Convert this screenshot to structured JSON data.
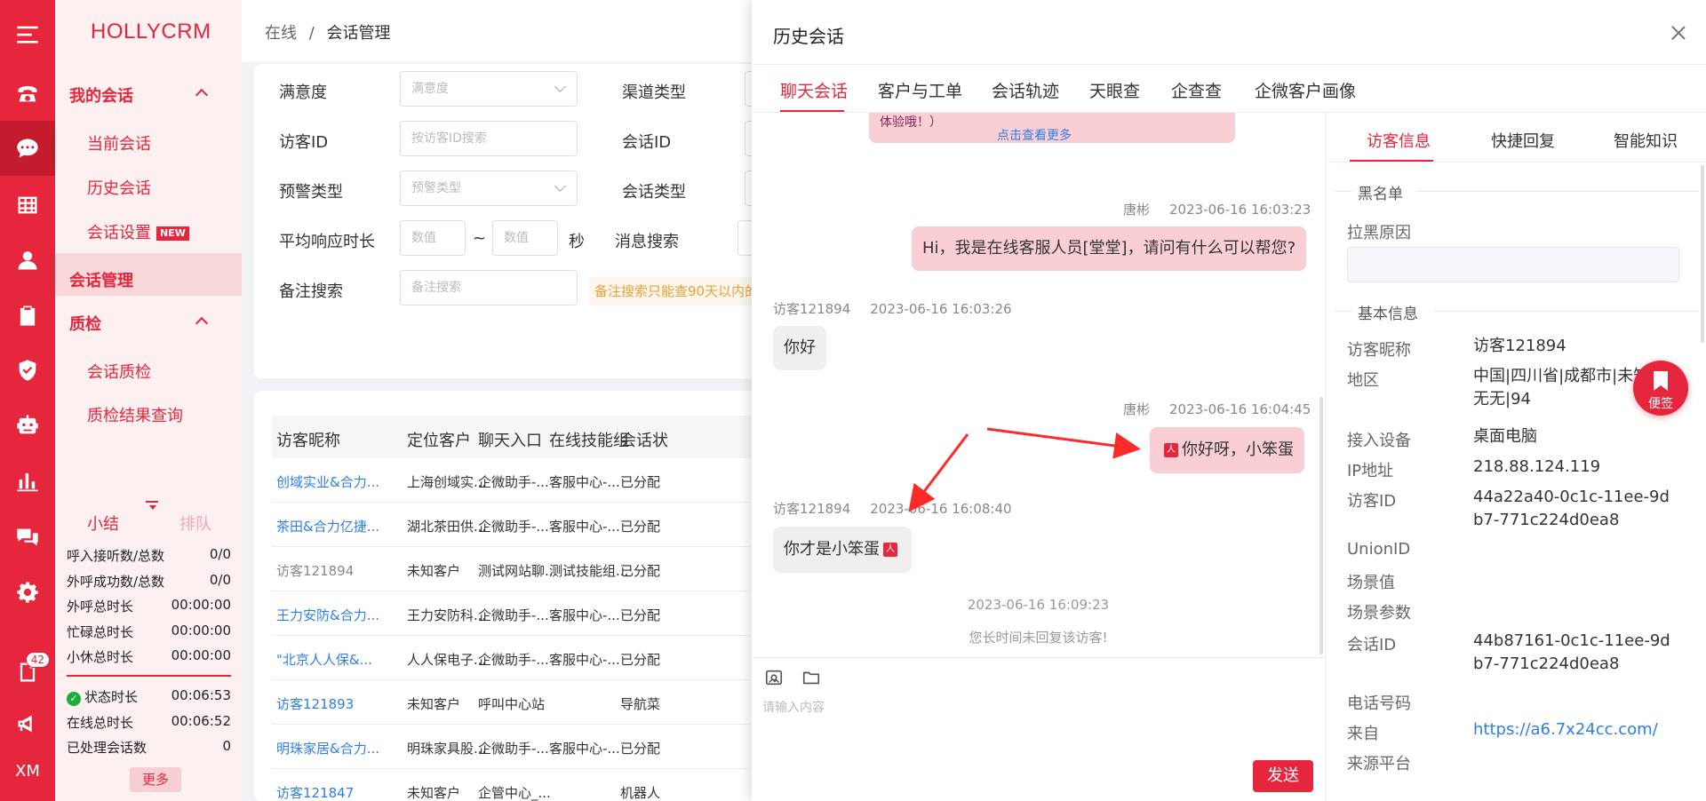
{
  "app": {
    "brand": "HOLLYCRM"
  },
  "rail": {
    "badge": "42",
    "footer": "XM"
  },
  "menu": {
    "group1": "我的会话",
    "items1": [
      "当前会话",
      "历史会话",
      "会话设置"
    ],
    "new_tag": "NEW",
    "active": "会话管理",
    "group2": "质检",
    "items2": [
      "会话质检",
      "质检结果查询"
    ],
    "stats_tabs": [
      "小结",
      "排队"
    ],
    "stats": [
      {
        "label": "呼入接听数/总数",
        "value": "0/0"
      },
      {
        "label": "外呼成功数/总数",
        "value": "0/0"
      },
      {
        "label": "外呼总时长",
        "value": "00:00:00"
      },
      {
        "label": "忙碌总时长",
        "value": "00:00:00"
      },
      {
        "label": "小休总时长",
        "value": "00:00:00"
      }
    ],
    "stats2": [
      {
        "label": "状态时长",
        "value": "00:06:53"
      },
      {
        "label": "在线总时长",
        "value": "00:06:52"
      },
      {
        "label": "已处理会话数",
        "value": "0"
      }
    ],
    "more": "更多"
  },
  "breadcrumb": {
    "root": "在线",
    "sep": "/",
    "current": "会话管理"
  },
  "filters": {
    "satisfaction": {
      "label": "满意度",
      "placeholder": "满意度"
    },
    "channel_type": {
      "label": "渠道类型"
    },
    "visitor_id": {
      "label": "访客ID",
      "placeholder": "按访客ID搜索"
    },
    "session_id": {
      "label": "会话ID"
    },
    "alert_type": {
      "label": "预警类型",
      "placeholder": "预警类型"
    },
    "session_type": {
      "label": "会话类型"
    },
    "avg_response": {
      "label": "平均响应时长",
      "min_placeholder": "数值",
      "tilde": "~",
      "max_placeholder": "数值",
      "unit": "秒"
    },
    "message_search": {
      "label": "消息搜索"
    },
    "note_search": {
      "label": "备注搜索",
      "placeholder": "备注搜索"
    },
    "tip": "备注搜索只能查90天以内的"
  },
  "table": {
    "headers": [
      "访客昵称",
      "定位客户",
      "聊天入口",
      "在线技能组",
      "会话状"
    ],
    "rows": [
      [
        "创域实业&合力...",
        "上海创域实...",
        "企微助手-...",
        "客服中心-...",
        "已分配"
      ],
      [
        "茶田&合力亿捷...",
        "湖北茶田供...",
        "企微助手-...",
        "客服中心-...",
        "已分配"
      ],
      [
        "访客121894",
        "未知客户",
        "测试网站聊...",
        "测试技能组...",
        "已分配"
      ],
      [
        "王力安防&合力...",
        "王力安防科...",
        "企微助手-...",
        "客服中心-...",
        "已分配"
      ],
      [
        "\"北京人人保&...",
        "人人保电子...",
        "企微助手-...",
        "客服中心-...",
        "已分配"
      ],
      [
        "访客121893",
        "未知客户",
        "呼叫中心站",
        "",
        "导航菜"
      ],
      [
        "明珠家居&合力...",
        "明珠家具股...",
        "企微助手-...",
        "客服中心-...",
        "已分配"
      ],
      [
        "访客121847",
        "未知客户",
        "企管中心_...",
        "",
        "机器人"
      ]
    ]
  },
  "drawer": {
    "title": "历史会话",
    "tabs": [
      "聊天会话",
      "客户与工单",
      "会话轨迹",
      "天眼查",
      "企查查",
      "企微客户画像"
    ],
    "load_more": "点击查看更多",
    "partial_msg": "体验哦！）",
    "messages": [
      {
        "sender": "唐彬",
        "time": "2023-06-16 16:03:23",
        "text": "Hi，我是在线客服人员[堂堂]，请问有什么可以帮您?"
      },
      {
        "sender": "访客121894",
        "time": "2023-06-16 16:03:26",
        "text": "你好"
      },
      {
        "sender": "唐彬",
        "time": "2023-06-16 16:04:45",
        "text": "你好呀，小笨蛋"
      },
      {
        "sender": "访客121894",
        "time": "2023-06-16 16:08:40",
        "text": "你才是小笨蛋"
      }
    ],
    "system_time": "2023-06-16 16:09:23",
    "system_msg": "您长时间未回复该访客!",
    "input_placeholder": "请输入内容",
    "send": "发送"
  },
  "info_panel": {
    "tabs": [
      "访客信息",
      "快捷回复",
      "智能知识"
    ],
    "blacklist_title": "黑名单",
    "block_reason_label": "拉黑原因",
    "basic_title": "基本信息",
    "fields": [
      {
        "key": "访客昵称",
        "value": "访客121894"
      },
      {
        "key": "地区",
        "value": "中国|四川省|成都市|未知|1无无|94"
      },
      {
        "key": "接入设备",
        "value": "桌面电脑"
      },
      {
        "key": "IP地址",
        "value": "218.88.124.119"
      },
      {
        "key": "访客ID",
        "value": "44a22a40-0c1c-11ee-9db7-771c224d0ea8"
      },
      {
        "key": "UnionID",
        "value": ""
      },
      {
        "key": "场景值",
        "value": ""
      },
      {
        "key": "场景参数",
        "value": ""
      },
      {
        "key": "会话ID",
        "value": "44b87161-0c1c-11ee-9db7-771c224d0ea8"
      },
      {
        "key": "电话号码",
        "value": ""
      },
      {
        "key": "来自",
        "value": "https://a6.7x24cc.com/"
      },
      {
        "key": "来源平台",
        "value": ""
      }
    ]
  },
  "note_button": "便签",
  "colors": {
    "accent": "#e6263c",
    "link": "#2f7ee6"
  }
}
